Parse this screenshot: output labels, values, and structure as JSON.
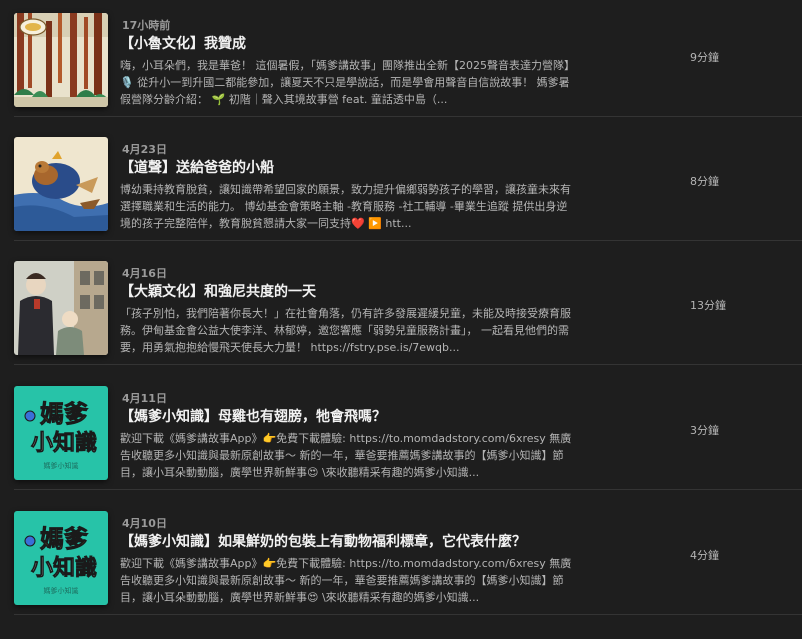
{
  "episodes": [
    {
      "date": "17小時前",
      "title": "【小魯文化】我贊成",
      "description": "嗨，小耳朵們，我是華爸！ 這個暑假，「媽爹講故事」團隊推出全新【2025聲音表達力營隊】🎙️ 從升小一到升國二都能參加，讓夏天不只是學說話，而是學會用聲音自信說故事！ 媽爹暑假營隊分齡介紹： 🌱 初階｜聲入其境故事營 feat. 童話透中島（...",
      "duration": "9分鐘",
      "thumb_icon": "forest-book-cover-icon"
    },
    {
      "date": "4月23日",
      "title": "【道聲】送給爸爸的小船",
      "description": "博幼秉持教育脫貧，讓知識帶希望回家的願景，致力提升偏鄉弱勢孩子的學習，讓孩童未來有選擇職業和生活的能力。 博幼基金會策略主軸 -教育服務 -社工輔導 -畢業生追蹤 提供出身逆境的孩子完整陪伴，教育脫貧懇請大家一同支持❤️ ▶️ htt...",
      "duration": "8分鐘",
      "thumb_icon": "beaver-boat-cover-icon"
    },
    {
      "date": "4月16日",
      "title": "【大穎文化】和強尼共度的一天",
      "description": "「孩子別怕，我們陪著你長大！」在社會角落，仍有許多發展遲緩兒童，未能及時接受療育服務。伊甸基金會公益大使李洋、林郁婷，邀您響應「弱勢兒童服務計畫」， 一起看見他們的需要，用勇氣抱抱給慢飛天使長大力量！ https://fstry.pse.is/7ewqb...",
      "duration": "13分鐘",
      "thumb_icon": "city-people-cover-icon"
    },
    {
      "date": "4月11日",
      "title": "【媽爹小知識】母雞也有翅膀，牠會飛嗎？",
      "description": "歡迎下載《媽爹講故事App》👉免費下載體驗: https://to.momdadstory.com/6xresy 無廣告收聽更多小知識與最新原創故事～ 新的一年，華爸要推薦媽爹講故事的【媽爹小知識】節目，讓小耳朵動動腦，廣學世界新鮮事😍 \\來收聽精采有趣的媽爹小知識...",
      "duration": "3分鐘",
      "thumb_icon": "momdad-knowledge-logo-icon",
      "thumb_text": [
        "媽爹",
        "小知識",
        "媽爹小知識"
      ]
    },
    {
      "date": "4月10日",
      "title": "【媽爹小知識】如果鮮奶的包裝上有動物福利標章，它代表什麼？",
      "description": "歡迎下載《媽爹講故事App》👉免費下載體驗: https://to.momdadstory.com/6xresy 無廣告收聽更多小知識與最新原創故事～ 新的一年，華爸要推薦媽爹講故事的【媽爹小知識】節目，讓小耳朵動動腦，廣學世界新鮮事😍 \\來收聽精采有趣的媽爹小知識...",
      "duration": "4分鐘",
      "thumb_icon": "momdad-knowledge-logo-icon",
      "thumb_text": [
        "媽爹",
        "小知識",
        "媽爹小知識"
      ]
    }
  ],
  "colors": {
    "background": "#1e1e1e",
    "divider": "#343434",
    "title": "#f2f2f2",
    "secondary": "#b4b4b4",
    "logo_teal": "#27c3a8",
    "logo_yellow": "#ffd43a"
  }
}
